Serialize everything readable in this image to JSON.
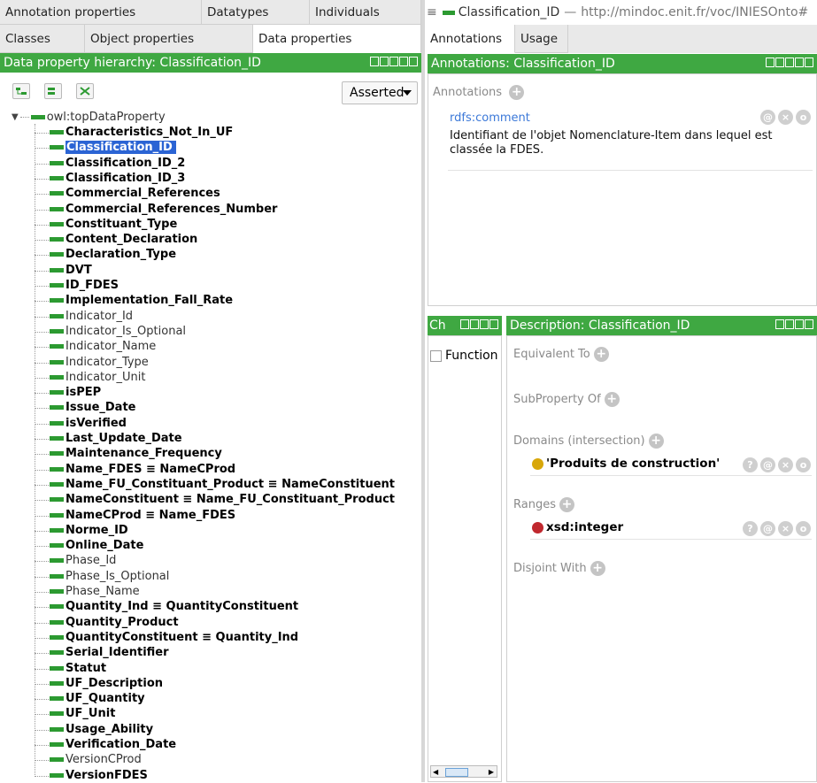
{
  "left_tabs_row1": [
    "Annotation properties",
    "Datatypes",
    "Individuals"
  ],
  "left_tabs_row2": [
    "Classes",
    "Object properties",
    "Data properties"
  ],
  "hierarchy": {
    "title": "Data property hierarchy: Classification_ID",
    "dropdown_value": "Asserted",
    "root": "owl:topDataProperty",
    "items": [
      {
        "label": "Characteristics_Not_In_UF",
        "bold": true
      },
      {
        "label": "Classification_ID",
        "bold": true,
        "selected": true
      },
      {
        "label": "Classification_ID_2",
        "bold": true
      },
      {
        "label": "Classification_ID_3",
        "bold": true
      },
      {
        "label": "Commercial_References",
        "bold": true
      },
      {
        "label": "Commercial_References_Number",
        "bold": true
      },
      {
        "label": "Constituant_Type",
        "bold": true
      },
      {
        "label": "Content_Declaration",
        "bold": true
      },
      {
        "label": "Declaration_Type",
        "bold": true
      },
      {
        "label": "DVT",
        "bold": true
      },
      {
        "label": "ID_FDES",
        "bold": true
      },
      {
        "label": "Implementation_Fall_Rate",
        "bold": true
      },
      {
        "label": "Indicator_Id",
        "bold": false
      },
      {
        "label": "Indicator_Is_Optional",
        "bold": false
      },
      {
        "label": "Indicator_Name",
        "bold": false
      },
      {
        "label": "Indicator_Type",
        "bold": false
      },
      {
        "label": "Indicator_Unit",
        "bold": false
      },
      {
        "label": "isPEP",
        "bold": true
      },
      {
        "label": "Issue_Date",
        "bold": true
      },
      {
        "label": "isVerified",
        "bold": true
      },
      {
        "label": "Last_Update_Date",
        "bold": true
      },
      {
        "label": "Maintenance_Frequency",
        "bold": true
      },
      {
        "label": "Name_FDES ≡ NameCProd",
        "bold": true
      },
      {
        "label": "Name_FU_Constituant_Product ≡ NameConstituent",
        "bold": true
      },
      {
        "label": "NameConstituent ≡ Name_FU_Constituant_Product",
        "bold": true
      },
      {
        "label": "NameCProd ≡ Name_FDES",
        "bold": true
      },
      {
        "label": "Norme_ID",
        "bold": true
      },
      {
        "label": "Online_Date",
        "bold": true
      },
      {
        "label": "Phase_Id",
        "bold": false
      },
      {
        "label": "Phase_Is_Optional",
        "bold": false
      },
      {
        "label": "Phase_Name",
        "bold": false
      },
      {
        "label": "Quantity_Ind ≡ QuantityConstituent",
        "bold": true
      },
      {
        "label": "Quantity_Product",
        "bold": true
      },
      {
        "label": "QuantityConstituent ≡ Quantity_Ind",
        "bold": true
      },
      {
        "label": "Serial_Identifier",
        "bold": true
      },
      {
        "label": "Statut",
        "bold": true
      },
      {
        "label": "UF_Description",
        "bold": true
      },
      {
        "label": "UF_Quantity",
        "bold": true
      },
      {
        "label": "UF_Unit",
        "bold": true
      },
      {
        "label": "Usage_Ability",
        "bold": true
      },
      {
        "label": "Verification_Date",
        "bold": true
      },
      {
        "label": "VersionCProd",
        "bold": false
      },
      {
        "label": "VersionFDES",
        "bold": true
      }
    ]
  },
  "right_header": {
    "menu_icon": "≡",
    "entity": "Classification_ID",
    "separator": "—",
    "iri": "http://mindoc.enit.fr/voc/INIESOnto#"
  },
  "right_tabs": [
    "Annotations",
    "Usage"
  ],
  "annotations_panel": {
    "title": "Annotations: Classification_ID",
    "section_label": "Annotations",
    "property": "rdfs:comment",
    "comment_text": "Identifiant de l'objet Nomenclature-Item dans lequel est classée la FDES."
  },
  "characteristics_panel": {
    "title": "Ch",
    "checkbox_label": "Function"
  },
  "description_panel": {
    "title": "Description: Classification_ID",
    "equivalent_to": "Equivalent To",
    "subproperty_of": "SubProperty Of",
    "domains_label": "Domains (intersection)",
    "domain_value": "'Produits de construction'",
    "ranges_label": "Ranges",
    "range_value": "xsd:integer",
    "disjoint_with": "Disjoint With"
  },
  "colors": {
    "green": "#3fa842",
    "selection": "#2b64d4",
    "domain_dot": "#d8a70a",
    "range_dot": "#c0282e"
  }
}
